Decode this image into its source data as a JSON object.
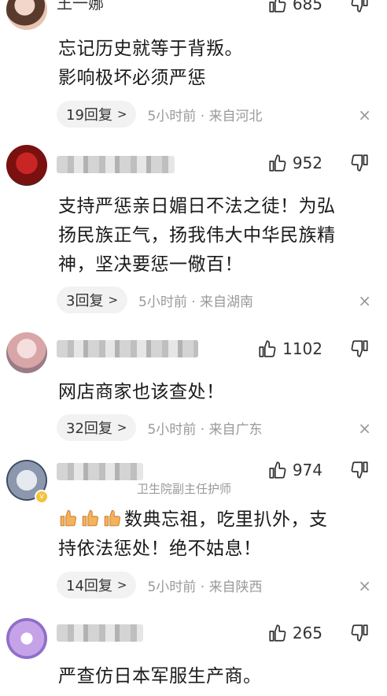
{
  "comments": [
    {
      "name": "王一娜",
      "likes": "685",
      "body_lines": [
        "忘记历史就等于背叛。",
        "影响极坏必须严惩"
      ],
      "replies": "19回复",
      "time_location": "5小时前 · 来自河北"
    },
    {
      "likes": "952",
      "body_lines": [
        "支持严惩亲日媚日不法之徒！为弘",
        "扬民族正气，扬我伟大中华民族精",
        "神，坚决要惩一儆百！"
      ],
      "replies": "3回复",
      "time_location": "5小时前 · 来自湖南"
    },
    {
      "likes": "1102",
      "body_lines": [
        "网店商家也该查处！"
      ],
      "replies": "32回复",
      "time_location": "5小时前 · 来自广东"
    },
    {
      "likes": "974",
      "subtitle": "卫生院副主任护师",
      "body_line1": "数典忘祖，吃里扒外，支",
      "body_line2": "持依法惩处！绝不姑息！",
      "replies": "14回复",
      "time_location": "5小时前 · 来自陕西"
    },
    {
      "likes": "265",
      "body_lines": [
        "严查仿日本军服生产商。"
      ]
    }
  ],
  "icons": {
    "like": "thumbs-up-outline",
    "dislike": "thumbs-down-outline",
    "close": "×",
    "chevron": "›"
  },
  "colors": {
    "meta_gray": "#9a9a9a",
    "pill_bg": "#f2f2f2",
    "text": "#1a1a1a"
  }
}
